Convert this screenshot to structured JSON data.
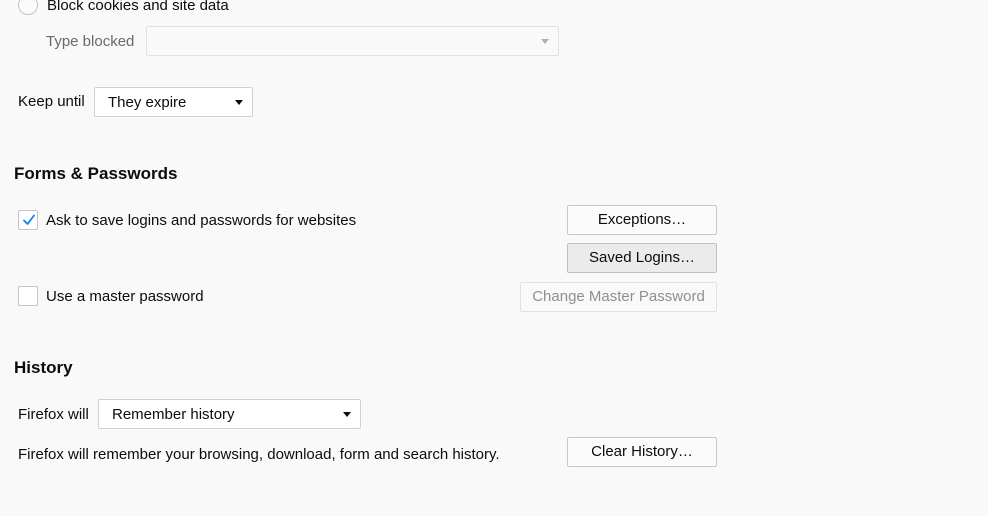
{
  "cookies": {
    "block_label": "Block cookies and site data",
    "block_selected": false,
    "type_blocked_label": "Type blocked",
    "type_blocked_value": "",
    "keep_until_label": "Keep until",
    "keep_until_value": "They expire"
  },
  "forms_passwords": {
    "heading": "Forms & Passwords",
    "ask_save_label": "Ask to save logins and passwords for websites",
    "ask_save_checked": true,
    "exceptions_label": "Exceptions…",
    "saved_logins_label": "Saved Logins…",
    "master_password_label": "Use a master password",
    "master_password_checked": false,
    "change_master_label": "Change Master Password"
  },
  "history": {
    "heading": "History",
    "firefox_will_label": "Firefox will",
    "firefox_will_value": "Remember history",
    "description": "Firefox will remember your browsing, download, form and search history.",
    "clear_history_label": "Clear History…"
  },
  "colors": {
    "checkmark": "#0a84ff",
    "background": "#f9f9f9"
  }
}
